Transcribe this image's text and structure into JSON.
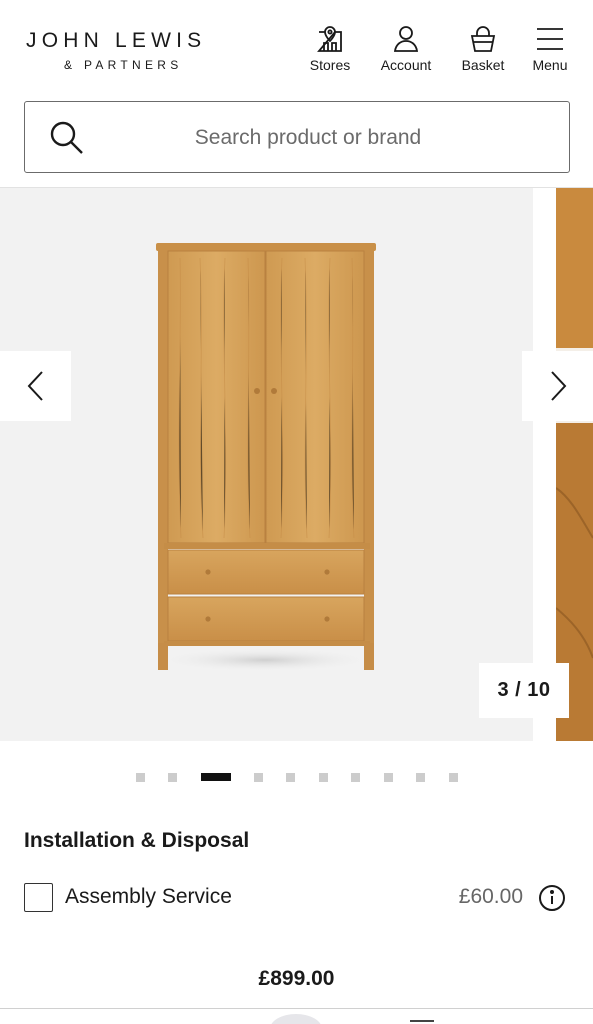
{
  "header": {
    "logo_main": "JOHN LEWIS",
    "logo_sub": "& PARTNERS",
    "nav": [
      {
        "label": "Stores",
        "icon": "store-icon"
      },
      {
        "label": "Account",
        "icon": "account-icon"
      },
      {
        "label": "Basket",
        "icon": "basket-icon"
      },
      {
        "label": "Menu",
        "icon": "menu-icon"
      }
    ]
  },
  "search": {
    "placeholder": "Search product or brand"
  },
  "gallery": {
    "counter": "3 / 10",
    "current_index": 3,
    "total": 10
  },
  "installation": {
    "title": "Installation & Disposal",
    "option_label": "Assembly Service",
    "option_price": "£60.00",
    "option_checked": false
  },
  "product": {
    "price": "£899.00"
  },
  "colors": {
    "text": "#1a1a1a",
    "muted": "#6b6b6b",
    "gallery_bg": "#f2f2f2",
    "dot_active": "#111111",
    "dot_inactive": "#cccccc",
    "wood": "#d9a75e"
  }
}
